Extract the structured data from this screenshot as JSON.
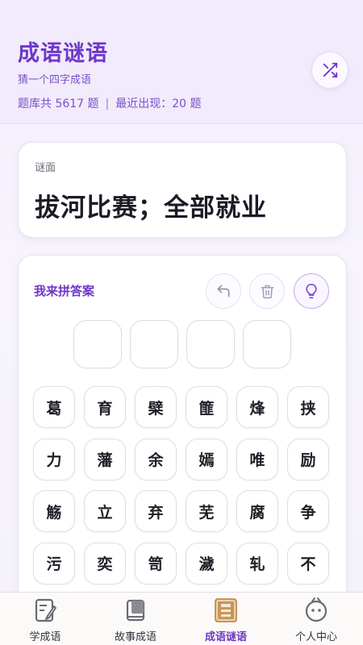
{
  "header": {
    "title": "成语谜语",
    "subtitle": "猜一个四字成语",
    "stats_total": "题库共 5617 题",
    "stats_separator": "|",
    "stats_recent": "最近出现：20 题",
    "shuffle_icon": "shuffle-icon"
  },
  "riddle": {
    "label": "谜面",
    "text": "拔河比赛；全部就业"
  },
  "answer": {
    "title": "我来拼答案",
    "tools": [
      "undo-icon",
      "trash-icon",
      "lightbulb-icon"
    ],
    "slots": [
      "",
      "",
      "",
      ""
    ],
    "chars": [
      "葛",
      "育",
      "檗",
      "篚",
      "烽",
      "挟",
      "力",
      "藩",
      "余",
      "嫣",
      "唯",
      "励",
      "觞",
      "立",
      "弃",
      "芜",
      "腐",
      "争",
      "污",
      "奕",
      "笥",
      "濊",
      "轧",
      "不"
    ]
  },
  "tabs": [
    {
      "label": "学成语",
      "icon": "book-pen-icon",
      "active": false
    },
    {
      "label": "故事成语",
      "icon": "storybook-icon",
      "active": false
    },
    {
      "label": "成语谜语",
      "icon": "riddle-seal-icon",
      "active": true
    },
    {
      "label": "个人中心",
      "icon": "profile-face-icon",
      "active": false
    }
  ],
  "colors": {
    "accent": "#6f37c9",
    "active_tab_icon": "#c8955a"
  }
}
